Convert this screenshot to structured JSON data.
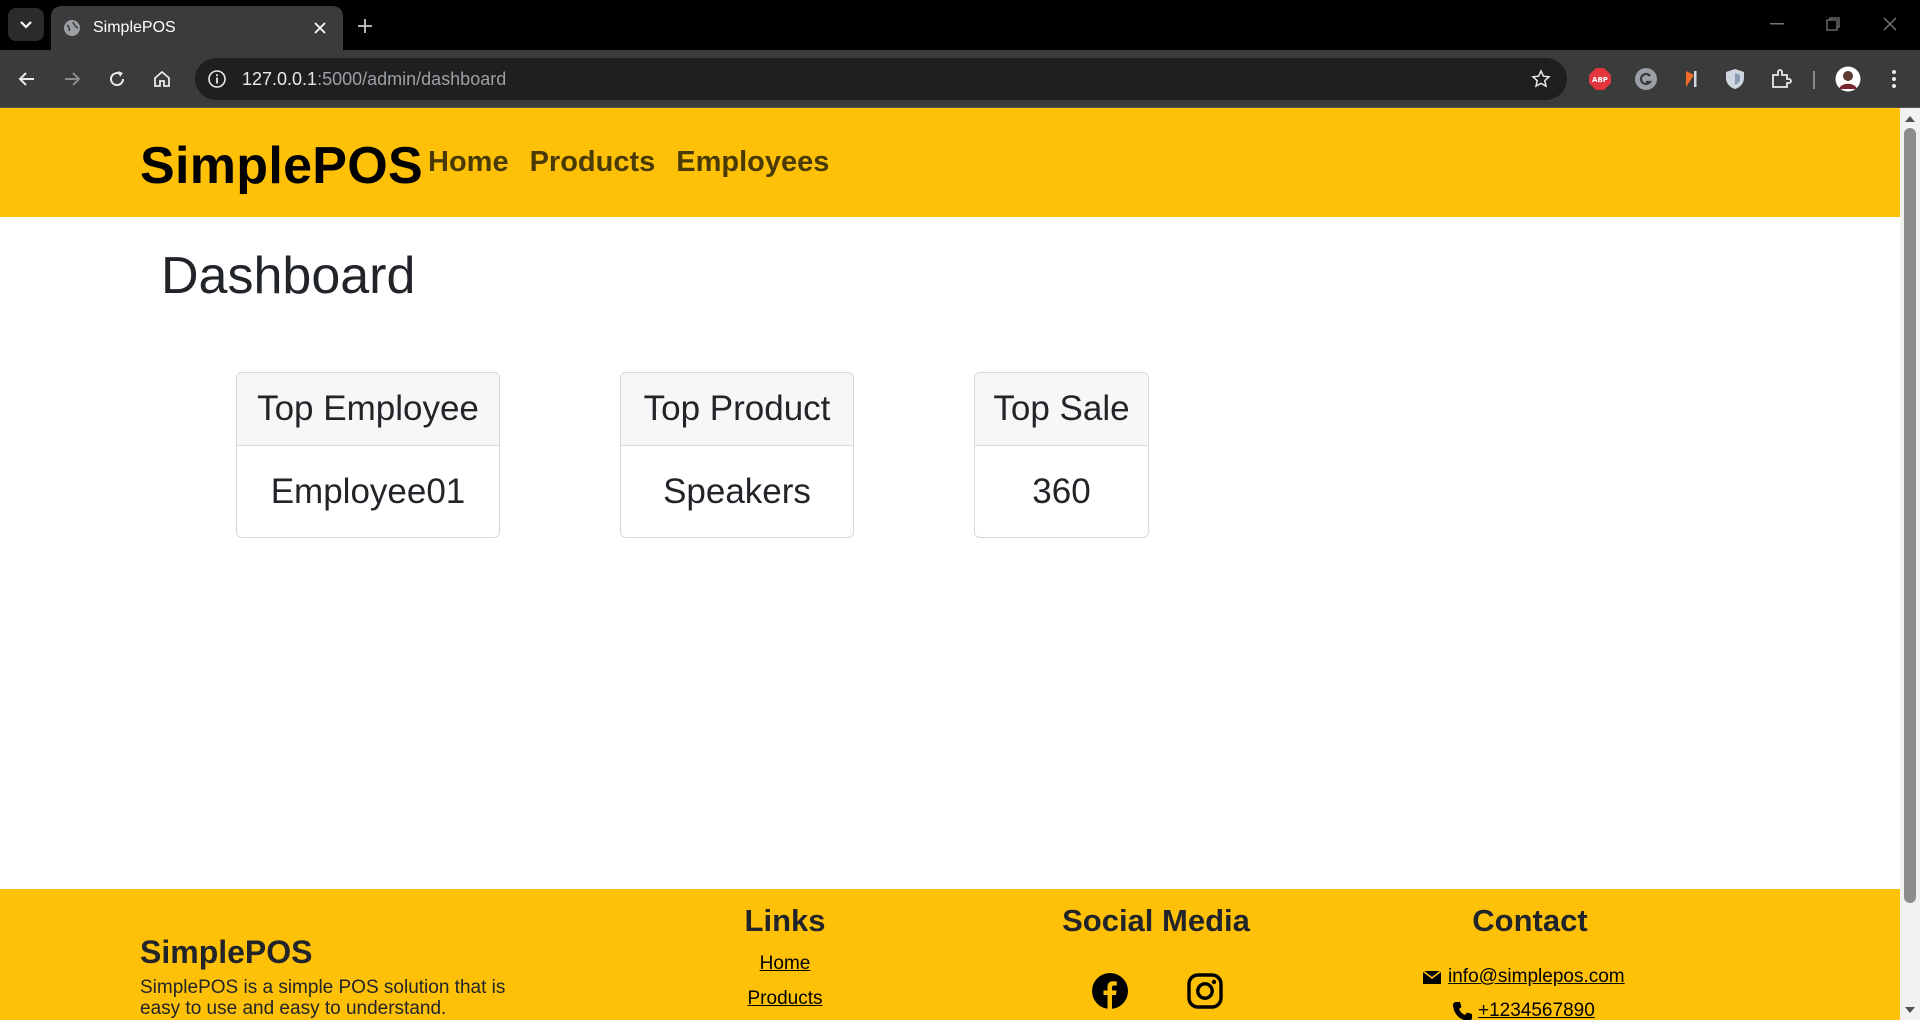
{
  "browser": {
    "tab_title": "SimplePOS",
    "url_host": "127.0.0.1",
    "url_rest": ":5000/admin/dashboard"
  },
  "navbar": {
    "brand": "SimplePOS",
    "links": [
      "Home",
      "Products",
      "Employees"
    ]
  },
  "main": {
    "title": "Dashboard",
    "cards": [
      {
        "header": "Top Employee",
        "value": "Employee01"
      },
      {
        "header": "Top Product",
        "value": "Speakers"
      },
      {
        "header": "Top Sale",
        "value": "360"
      }
    ]
  },
  "footer": {
    "brand": "SimplePOS",
    "description": "SimplePOS is a simple POS solution that is easy to use and easy to understand.",
    "links_heading": "Links",
    "links": [
      "Home",
      "Products"
    ],
    "social_heading": "Social Media",
    "contact_heading": "Contact",
    "email": "info@simplepos.com",
    "phone": "+1234567890"
  },
  "colors": {
    "brand_yellow": "#ffc107",
    "chrome_dark": "#3b3b3b"
  }
}
